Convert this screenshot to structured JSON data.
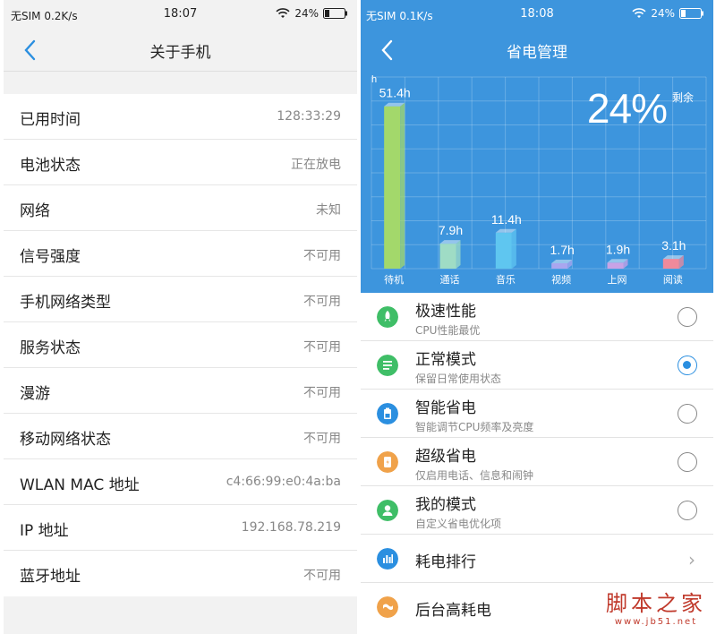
{
  "left": {
    "status": {
      "carrier": "无SIM 0.2K/s",
      "time": "18:07",
      "battery": "24%"
    },
    "title": "关于手机",
    "rows": [
      {
        "label": "已用时间",
        "value": "128:33:29"
      },
      {
        "label": "电池状态",
        "value": "正在放电"
      },
      {
        "label": "网络",
        "value": "未知"
      },
      {
        "label": "信号强度",
        "value": "不可用"
      },
      {
        "label": "手机网络类型",
        "value": "不可用"
      },
      {
        "label": "服务状态",
        "value": "不可用"
      },
      {
        "label": "漫游",
        "value": "不可用"
      },
      {
        "label": "移动网络状态",
        "value": "不可用"
      },
      {
        "label": "WLAN MAC 地址",
        "value": "c4:66:99:e0:4a:ba"
      },
      {
        "label": "IP 地址",
        "value": "192.168.78.219"
      },
      {
        "label": "蓝牙地址",
        "value": "不可用"
      }
    ]
  },
  "right": {
    "status": {
      "carrier": "无SIM 0.1K/s",
      "time": "18:08",
      "battery": "24%"
    },
    "title": "省电管理",
    "battery_percent": "24%",
    "battery_sub": "剩余",
    "modes": [
      {
        "title": "极速性能",
        "desc": "CPU性能最优",
        "icon": "rocket-icon",
        "color": "#3fbe67",
        "selected": false
      },
      {
        "title": "正常模式",
        "desc": "保留日常使用状态",
        "icon": "list-icon",
        "color": "#3fbe67",
        "selected": true
      },
      {
        "title": "智能省电",
        "desc": "智能调节CPU频率及亮度",
        "icon": "battery-icon",
        "color": "#2b8fe0",
        "selected": false
      },
      {
        "title": "超级省电",
        "desc": "仅启用电话、信息和闹钟",
        "icon": "save-icon",
        "color": "#f0a24a",
        "selected": false
      },
      {
        "title": "我的模式",
        "desc": "自定义省电优化项",
        "icon": "user-icon",
        "color": "#3fbe67",
        "selected": false
      }
    ],
    "extra": [
      {
        "title": "耗电排行",
        "icon": "bar-chart-icon",
        "color": "#2b8fe0"
      },
      {
        "title": "后台高耗电",
        "icon": "background-icon",
        "color": "#f0a24a"
      }
    ],
    "colors": {
      "header_bg": "#3d95dd",
      "accent": "#2b8fe0"
    }
  },
  "chart_data": {
    "type": "bar",
    "ylabel": "h",
    "categories": [
      "待机",
      "通话",
      "音乐",
      "视频",
      "上网",
      "阅读"
    ],
    "values": [
      51.4,
      7.9,
      11.4,
      1.7,
      1.9,
      3.1
    ],
    "value_labels": [
      "51.4h",
      "7.9h",
      "11.4h",
      "1.7h",
      "1.9h",
      "3.1h"
    ],
    "colors": [
      "#a3d86b",
      "#9fdcc5",
      "#5fc6f0",
      "#a9a6ef",
      "#c9a3e6",
      "#f08a9b"
    ],
    "ylim": [
      0,
      60
    ],
    "grid": true
  },
  "watermark": {
    "line1": "脚本之家",
    "line2": "www.jb51.net"
  }
}
